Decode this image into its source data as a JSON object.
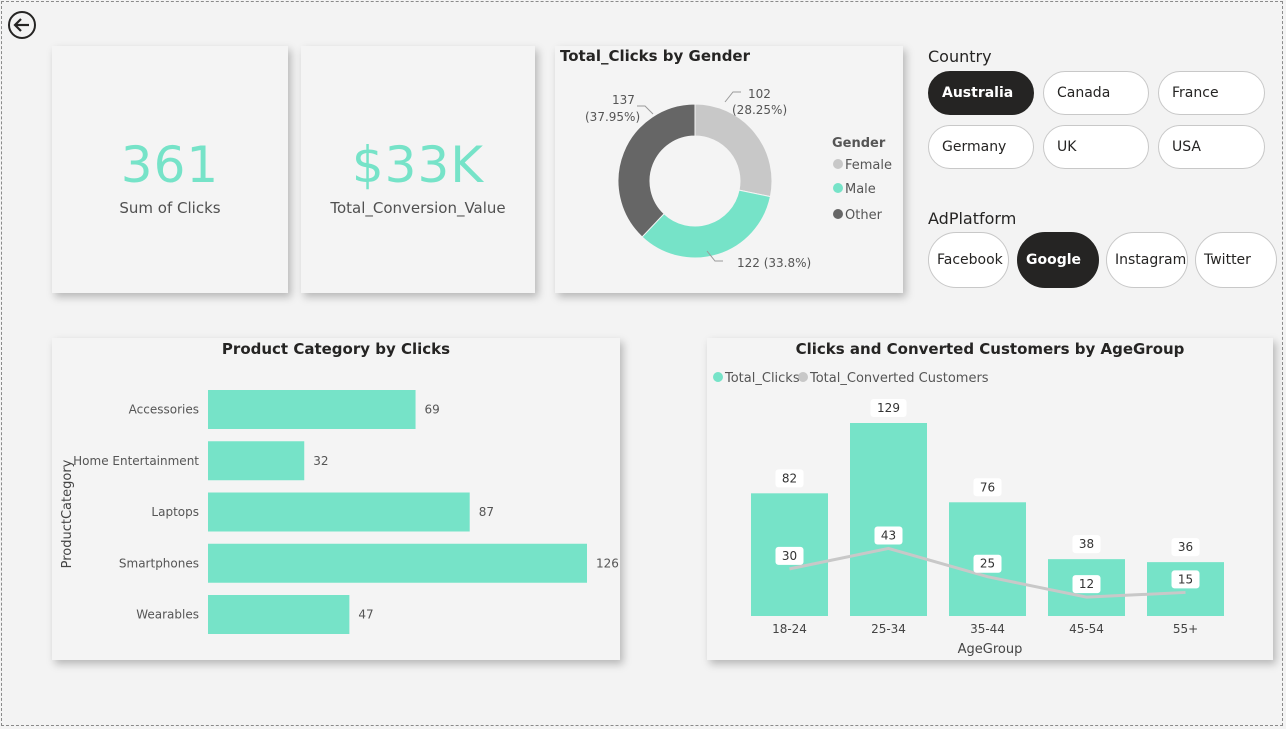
{
  "kpis": {
    "clicks": {
      "value": "361",
      "label": "Sum of Clicks"
    },
    "conversion": {
      "value": "$33K",
      "label": "Total_Conversion_Value"
    }
  },
  "colors": {
    "accent": "#76e3c8",
    "female": "#c8c8c8",
    "other": "#666666",
    "dark": "#252423"
  },
  "icons": {
    "back": "arrow-left-circle-icon"
  },
  "gender_chart": {
    "title": "Total_Clicks by Gender",
    "legend_title": "Gender",
    "legend": [
      "Female",
      "Male",
      "Other"
    ],
    "labels": {
      "female": [
        "102",
        "(28.25%)"
      ],
      "male": "122 (33.8%)",
      "other": [
        "137",
        "(37.95%)"
      ]
    }
  },
  "slicers": {
    "country": {
      "title": "Country",
      "options": [
        "Australia",
        "Canada",
        "France",
        "Germany",
        "UK",
        "USA"
      ],
      "selected": "Australia"
    },
    "adplatform": {
      "title": "AdPlatform",
      "options": [
        "Facebook",
        "Google",
        "Instagram",
        "Twitter"
      ],
      "selected": "Google"
    }
  },
  "product_chart": {
    "title": "Product Category by Clicks",
    "ylabel": "ProductCategory"
  },
  "age_chart": {
    "title": "Clicks and Converted Customers by AgeGroup",
    "xlabel": "AgeGroup",
    "legend": [
      "Total_Clicks",
      "Total_Converted Customers"
    ]
  },
  "chart_data": [
    {
      "type": "pie",
      "categories": [
        "Female",
        "Male",
        "Other"
      ],
      "values": [
        102,
        122,
        137
      ],
      "percentages": [
        28.25,
        33.8,
        37.95
      ],
      "title": "Total_Clicks by Gender",
      "legend_title": "Gender",
      "legend_position": "right"
    },
    {
      "type": "bar",
      "orientation": "horizontal",
      "categories": [
        "Accessories",
        "Home Entertainment",
        "Laptops",
        "Smartphones",
        "Wearables"
      ],
      "values": [
        69,
        32,
        87,
        126,
        47
      ],
      "title": "Product Category by Clicks",
      "xlabel": "",
      "ylabel": "ProductCategory",
      "xlim": [
        0,
        126
      ]
    },
    {
      "type": "bar",
      "categories": [
        "18-24",
        "25-34",
        "35-44",
        "45-54",
        "55+"
      ],
      "series": [
        {
          "name": "Total_Clicks",
          "type": "bar",
          "values": [
            82,
            129,
            76,
            38,
            36
          ]
        },
        {
          "name": "Total_Converted Customers",
          "type": "line",
          "values": [
            30,
            43,
            25,
            12,
            15
          ]
        }
      ],
      "title": "Clicks and Converted Customers by AgeGroup",
      "xlabel": "AgeGroup",
      "ylabel": "",
      "ylim": [
        0,
        129
      ],
      "legend_position": "top-left"
    }
  ]
}
